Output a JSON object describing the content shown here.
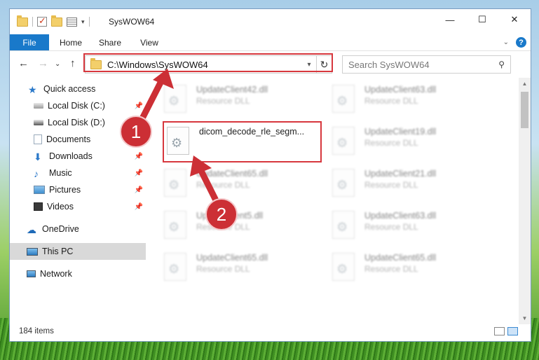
{
  "window": {
    "title": "SysWOW64",
    "controls": {
      "minimize": "—",
      "maximize": "☐",
      "close": "✕"
    }
  },
  "ribbon": {
    "tabs": [
      {
        "label": "File",
        "active": true
      },
      {
        "label": "Home"
      },
      {
        "label": "Share"
      },
      {
        "label": "View"
      }
    ]
  },
  "nav": {
    "address": "C:\\Windows\\SysWOW64",
    "search_placeholder": "Search SysWOW64"
  },
  "sidebar": {
    "items": [
      {
        "label": "Quick access",
        "icon": "star-icon"
      },
      {
        "label": "Local Disk (C:)",
        "icon": "drive-icon",
        "pinned": true
      },
      {
        "label": "Local Disk (D:)",
        "icon": "drive-icon"
      },
      {
        "label": "Documents",
        "icon": "documents-icon",
        "pinned": true
      },
      {
        "label": "Downloads",
        "icon": "download-icon",
        "pinned": true
      },
      {
        "label": "Music",
        "icon": "music-icon",
        "pinned": true
      },
      {
        "label": "Pictures",
        "icon": "pictures-icon",
        "pinned": true
      },
      {
        "label": "Videos",
        "icon": "videos-icon",
        "pinned": true
      },
      {
        "label": "OneDrive",
        "icon": "cloud-icon"
      },
      {
        "label": "This PC",
        "icon": "computer-icon",
        "selected": true
      },
      {
        "label": "Network",
        "icon": "network-icon"
      }
    ]
  },
  "files": [
    {
      "name": "UpdateClient42.dll",
      "type": "Resource DLL",
      "blurred": true
    },
    {
      "name": "UpdateClient63.dll",
      "type": "Resource DLL",
      "blurred": true
    },
    {
      "name": "dicom_decode_rle_segm...",
      "type": "",
      "blurred": false,
      "highlighted": true
    },
    {
      "name": "UpdateClient19.dll",
      "type": "Resource DLL",
      "blurred": true
    },
    {
      "name": "UpdateClient65.dll",
      "type": "Resource DLL",
      "blurred": true
    },
    {
      "name": "UpdateClient21.dll",
      "type": "Resource DLL",
      "blurred": true
    },
    {
      "name": "UpdateClient5.dll",
      "type": "Resource DLL",
      "blurred": true
    },
    {
      "name": "UpdateClient63.dll",
      "type": "Resource DLL",
      "blurred": true
    },
    {
      "name": "UpdateClient65.dll",
      "type": "Resource DLL",
      "blurred": true
    },
    {
      "name": "UpdateClient65.dll",
      "type": "Resource DLL",
      "blurred": true
    }
  ],
  "status": {
    "item_count": "184 items"
  },
  "annotations": {
    "step1": "1",
    "step2": "2",
    "color": "#d7373d"
  }
}
